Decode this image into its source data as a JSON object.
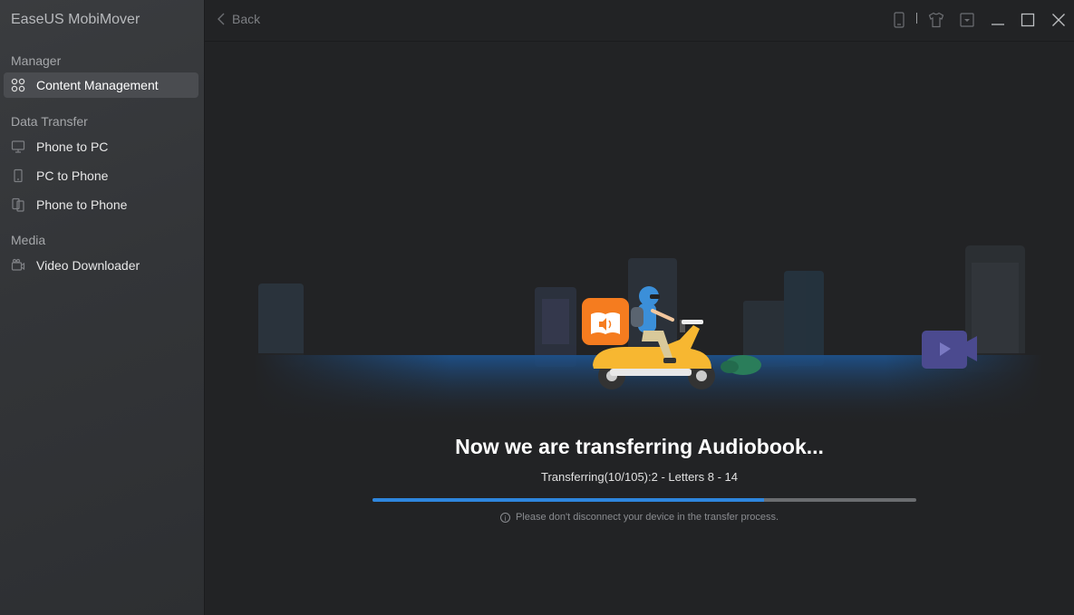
{
  "app": {
    "title": "EaseUS MobiMover"
  },
  "sidebar": {
    "sections": [
      {
        "label": "Manager"
      },
      {
        "label": "Data Transfer"
      },
      {
        "label": "Media"
      }
    ],
    "items": [
      {
        "label": "Content Management",
        "icon": "grid-icon",
        "active": true
      },
      {
        "label": "Phone to PC",
        "icon": "monitor-icon"
      },
      {
        "label": "PC to Phone",
        "icon": "phone-icon"
      },
      {
        "label": "Phone to Phone",
        "icon": "phones-icon"
      },
      {
        "label": "Video Downloader",
        "icon": "video-camera-icon"
      }
    ]
  },
  "topbar": {
    "back_label": "Back",
    "icons": [
      "device-icon",
      "tshirt-icon",
      "dropdown-icon",
      "minimize-icon",
      "maximize-icon",
      "close-icon"
    ]
  },
  "transfer": {
    "headline": "Now we are transferring Audiobook...",
    "status": "Transferring(10/105):2 - Letters 8 - 14",
    "progress": 0.72,
    "notice": "Please don't disconnect your device in the transfer process."
  },
  "colors": {
    "accent": "#2e86de",
    "audiobook": "#f57c1f",
    "scooter": "#f7b731"
  }
}
